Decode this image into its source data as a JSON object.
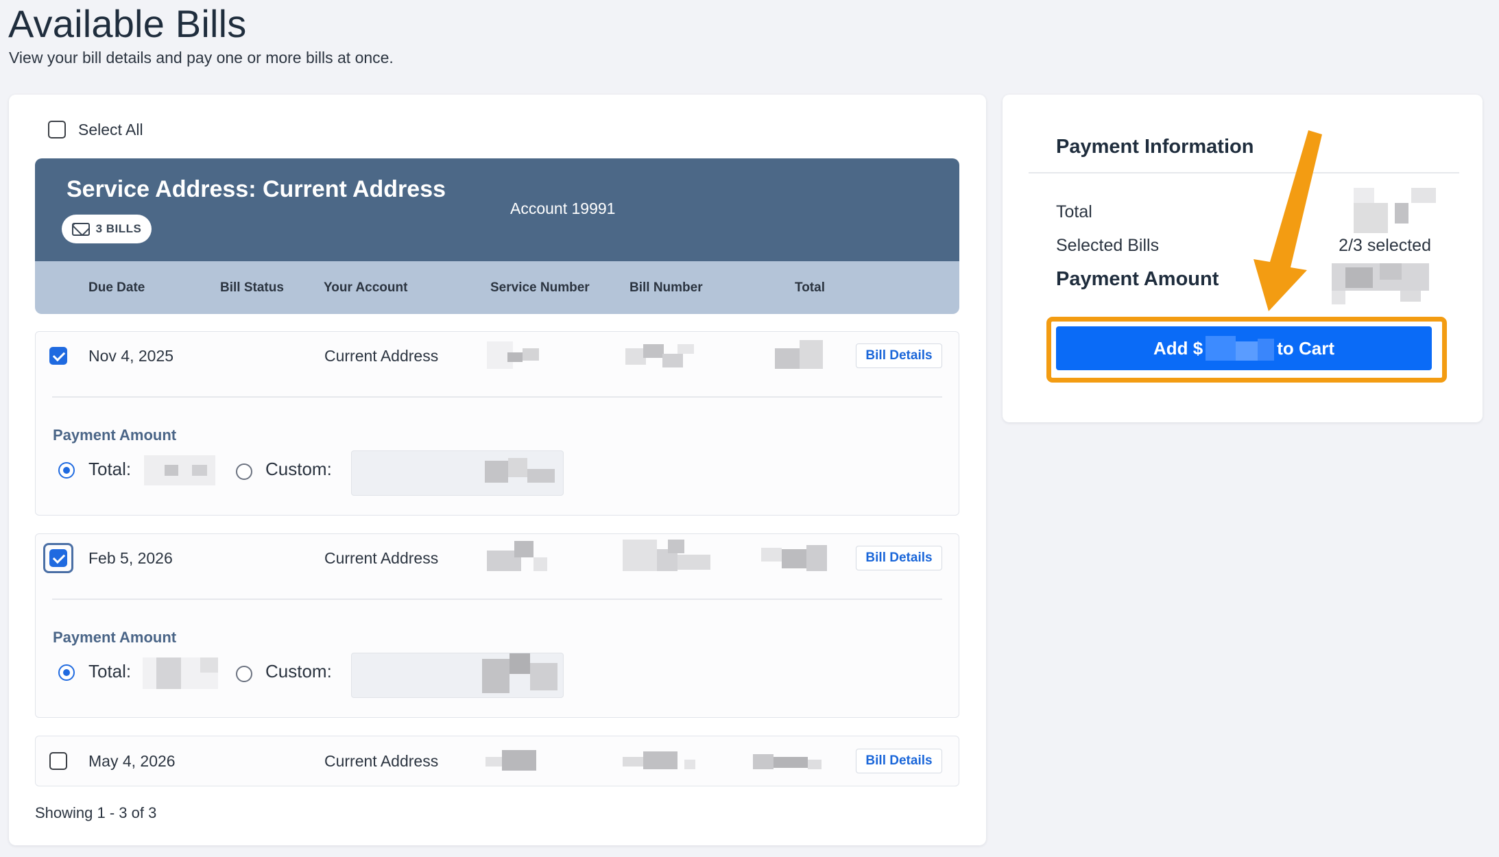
{
  "page": {
    "title": "Available Bills",
    "subtitle": "View your bill details and pay one or more bills at once."
  },
  "bills_panel": {
    "select_all_label": "Select All",
    "group": {
      "title": "Service Address: Current Address",
      "account": "Account 19991",
      "bill_count_badge": "3 BILLS"
    },
    "columns": [
      "Due Date",
      "Bill Status",
      "Your Account",
      "Service Number",
      "Bill Number",
      "Total"
    ],
    "bills": [
      {
        "due_date": "Nov 4, 2025",
        "account": "Current Address",
        "checked": true,
        "details_label": "Bill Details",
        "payment_amount_label": "Payment Amount",
        "total_label": "Total:",
        "custom_label": "Custom:",
        "total_selected": true
      },
      {
        "due_date": "Feb 5, 2026",
        "account": "Current Address",
        "checked": true,
        "details_label": "Bill Details",
        "payment_amount_label": "Payment Amount",
        "total_label": "Total:",
        "custom_label": "Custom:",
        "total_selected": true
      },
      {
        "due_date": "May 4, 2026",
        "account": "Current Address",
        "checked": false,
        "details_label": "Bill Details"
      }
    ],
    "showing_text": "Showing 1 - 3 of 3"
  },
  "payment_info": {
    "title": "Payment Information",
    "total_label": "Total",
    "selected_bills_label": "Selected Bills",
    "selected_bills_value": "2/3 selected",
    "payment_amount_label": "Payment Amount",
    "cart_button_prefix": "Add $",
    "cart_button_suffix": "to Cart"
  },
  "colors": {
    "group_header": "#4c6887",
    "column_header": "#b4c4d8",
    "primary_button": "#0a6bf7",
    "annotation_arrow": "#f39c12",
    "link": "#1a66d9"
  },
  "icons": [
    "mail-icon",
    "checkbox-icon",
    "radio-icon",
    "annotation-arrow-icon"
  ]
}
